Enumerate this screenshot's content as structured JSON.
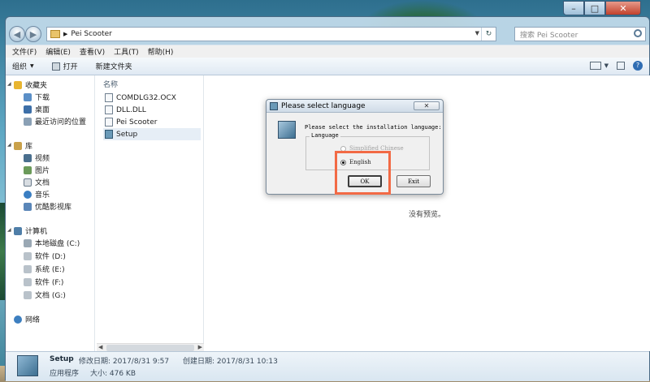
{
  "window": {
    "address_crumb": "Pei Scooter",
    "search_placeholder": "搜索 Pei Scooter"
  },
  "menu": [
    "文件(F)",
    "编辑(E)",
    "查看(V)",
    "工具(T)",
    "帮助(H)"
  ],
  "toolbar": {
    "organize": "组织",
    "open": "打开",
    "new_folder": "新建文件夹"
  },
  "nav": {
    "favorites": "收藏夹",
    "favorites_items": [
      "下载",
      "桌面",
      "最近访问的位置"
    ],
    "libraries": "库",
    "library_items": [
      "视频",
      "图片",
      "文档",
      "音乐",
      "优酷影视库"
    ],
    "computer": "计算机",
    "drives": [
      "本地磁盘 (C:)",
      "软件 (D:)",
      "系统 (E:)",
      "软件 (F:)",
      "文档 (G:)"
    ],
    "network": "网络"
  },
  "files": {
    "column_header": "名称",
    "items": [
      "COMDLG32.OCX",
      "DLL.DLL",
      "Pei Scooter",
      "Setup"
    ]
  },
  "preview": {
    "no_preview": "没有预览。"
  },
  "details": {
    "name": "Setup",
    "type": "应用程序",
    "modified": "修改日期: 2017/8/31 9:57",
    "size": "大小: 476 KB",
    "created": "创建日期: 2017/8/31 10:13"
  },
  "dialog": {
    "title": "Please select language",
    "prompt": "Please select the installation language:",
    "group_label": "Language",
    "option_chinese": "Simplified Chinese",
    "option_english": "English",
    "ok_label": "OK",
    "exit_label": "Exit",
    "selected": "English"
  },
  "colors": {
    "highlight": "#f26a45",
    "selection": "#e6eef6"
  }
}
